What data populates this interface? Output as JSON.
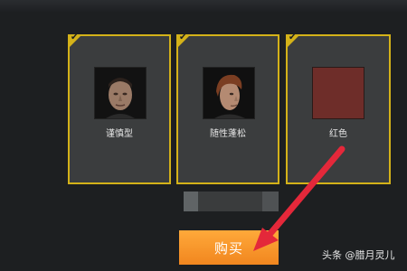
{
  "cards": [
    {
      "label": "谨慎型",
      "icon": "male-face-short-hair-icon"
    },
    {
      "label": "随性蓬松",
      "icon": "male-face-fluffy-hair-icon"
    },
    {
      "label": "红色",
      "icon": "red-color-swatch-icon",
      "swatch_color": "#6e2d29"
    }
  ],
  "selected_check": "✔",
  "buy_button": {
    "label": "购买"
  },
  "watermark": "头条 @腊月灵儿",
  "colors": {
    "accent_border": "#d4b219",
    "button": "#f1861f",
    "arrow": "#e4283a"
  }
}
